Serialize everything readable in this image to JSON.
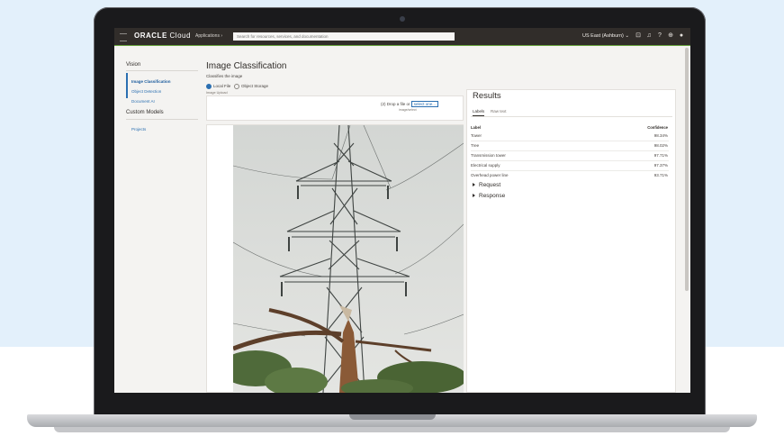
{
  "topbar": {
    "logo_brand": "ORACLE",
    "logo_product": "Cloud",
    "applications": "Applications ›",
    "search_placeholder": "Search for resources, services, and documentation",
    "region": "US East (Ashburn) ⌄",
    "icons": [
      "code-editor-icon",
      "bell-icon",
      "help-icon",
      "globe-icon",
      "user-icon"
    ]
  },
  "sidebar": {
    "section_title": "Vision",
    "items": [
      "Image Classification",
      "Object Detection",
      "Document AI"
    ],
    "section2_title": "Custom Models",
    "section2_items": [
      "Projects"
    ]
  },
  "main": {
    "title": "Image Classification",
    "subtitle": "Classifies the image",
    "source_local": "Local File",
    "source_object": "Object Storage",
    "image_upload_label": "Image Upload",
    "drop_text": "(2) Drop a file or",
    "drop_link": "select one...",
    "drop_sub": "image/select"
  },
  "results": {
    "title": "Results",
    "tabs": [
      "Labels",
      "Raw text"
    ],
    "col_label": "Label",
    "col_conf": "Confidence",
    "rows": [
      {
        "label": "Tower",
        "confidence": "98.34%"
      },
      {
        "label": "Tree",
        "confidence": "98.02%"
      },
      {
        "label": "Transmission tower",
        "confidence": "97.71%"
      },
      {
        "label": "Electrical supply",
        "confidence": "97.37%"
      },
      {
        "label": "Overhead power line",
        "confidence": "93.71%"
      }
    ],
    "request": "Request",
    "response": "Response"
  },
  "colors": {
    "topbar": "#312d2a",
    "link": "#2b6fb1",
    "accent": "#66a13b"
  }
}
